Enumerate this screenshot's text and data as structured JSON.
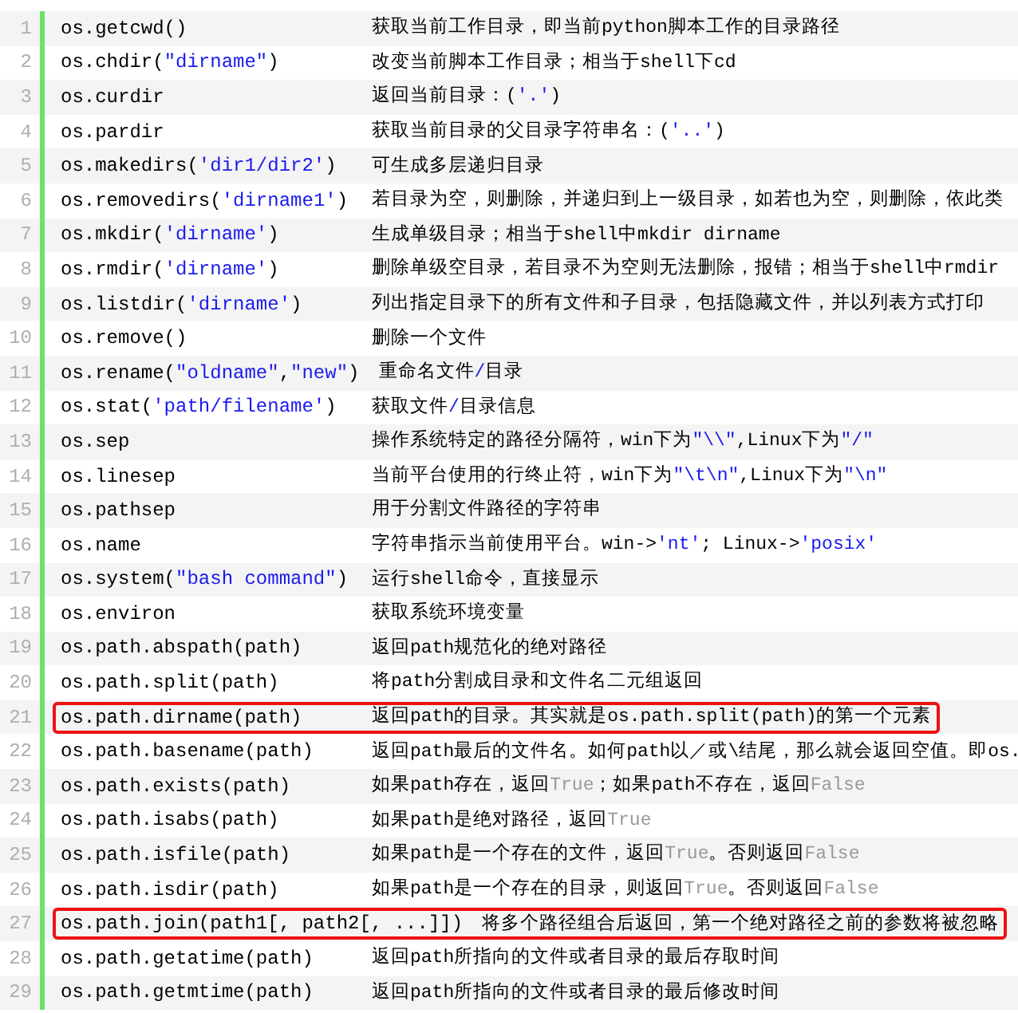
{
  "lines": [
    {
      "number": "1",
      "highlighted": false,
      "code": [
        {
          "text": "os.getcwd()",
          "kind": "plain"
        }
      ],
      "description": [
        {
          "text": "获取当前工作目录，即当前python脚本工作的目录路径",
          "kind": "plain"
        }
      ]
    },
    {
      "number": "2",
      "highlighted": false,
      "code": [
        {
          "text": "os.chdir(",
          "kind": "plain"
        },
        {
          "text": "\"dirname\"",
          "kind": "string"
        },
        {
          "text": ")",
          "kind": "plain"
        }
      ],
      "description": [
        {
          "text": "改变当前脚本工作目录；相当于shell下cd",
          "kind": "plain"
        }
      ]
    },
    {
      "number": "3",
      "highlighted": false,
      "code": [
        {
          "text": "os.curdir",
          "kind": "plain"
        }
      ],
      "description": [
        {
          "text": "返回当前目录：(",
          "kind": "plain"
        },
        {
          "text": "'.'",
          "kind": "string"
        },
        {
          "text": ")",
          "kind": "plain"
        }
      ]
    },
    {
      "number": "4",
      "highlighted": false,
      "code": [
        {
          "text": "os.pardir",
          "kind": "plain"
        }
      ],
      "description": [
        {
          "text": "获取当前目录的父目录字符串名：(",
          "kind": "plain"
        },
        {
          "text": "'..'",
          "kind": "string"
        },
        {
          "text": ")",
          "kind": "plain"
        }
      ]
    },
    {
      "number": "5",
      "highlighted": false,
      "code": [
        {
          "text": "os.makedirs(",
          "kind": "plain"
        },
        {
          "text": "'dir1/dir2'",
          "kind": "string"
        },
        {
          "text": ")",
          "kind": "plain"
        }
      ],
      "description": [
        {
          "text": "可生成多层递归目录",
          "kind": "plain"
        }
      ]
    },
    {
      "number": "6",
      "highlighted": false,
      "code": [
        {
          "text": "os.removedirs(",
          "kind": "plain"
        },
        {
          "text": "'dirname1'",
          "kind": "string"
        },
        {
          "text": ")",
          "kind": "plain"
        }
      ],
      "description": [
        {
          "text": "若目录为空，则删除，并递归到上一级目录，如若也为空，则删除，依此类",
          "kind": "plain"
        }
      ]
    },
    {
      "number": "7",
      "highlighted": false,
      "code": [
        {
          "text": "os.mkdir(",
          "kind": "plain"
        },
        {
          "text": "'dirname'",
          "kind": "string"
        },
        {
          "text": ")",
          "kind": "plain"
        }
      ],
      "description": [
        {
          "text": "生成单级目录；相当于shell中mkdir dirname",
          "kind": "plain"
        }
      ]
    },
    {
      "number": "8",
      "highlighted": false,
      "code": [
        {
          "text": "os.rmdir(",
          "kind": "plain"
        },
        {
          "text": "'dirname'",
          "kind": "string"
        },
        {
          "text": ")",
          "kind": "plain"
        }
      ],
      "description": [
        {
          "text": "删除单级空目录，若目录不为空则无法删除，报错；相当于shell中rmdir",
          "kind": "plain"
        }
      ]
    },
    {
      "number": "9",
      "highlighted": false,
      "code": [
        {
          "text": "os.listdir(",
          "kind": "plain"
        },
        {
          "text": "'dirname'",
          "kind": "string"
        },
        {
          "text": ")",
          "kind": "plain"
        }
      ],
      "description": [
        {
          "text": "列出指定目录下的所有文件和子目录，包括隐藏文件，并以列表方式打印",
          "kind": "plain"
        }
      ]
    },
    {
      "number": "10",
      "highlighted": false,
      "code": [
        {
          "text": "os.remove()",
          "kind": "plain"
        }
      ],
      "description": [
        {
          "text": "删除一个文件",
          "kind": "plain"
        }
      ]
    },
    {
      "number": "11",
      "highlighted": false,
      "code": [
        {
          "text": "os.rename(",
          "kind": "plain"
        },
        {
          "text": "\"oldname\"",
          "kind": "string"
        },
        {
          "text": ",",
          "kind": "plain"
        },
        {
          "text": "\"new\"",
          "kind": "string"
        },
        {
          "text": ")",
          "kind": "plain"
        }
      ],
      "description": [
        {
          "text": "重命名文件",
          "kind": "plain"
        },
        {
          "text": "/",
          "kind": "string"
        },
        {
          "text": "目录",
          "kind": "plain"
        }
      ]
    },
    {
      "number": "12",
      "highlighted": false,
      "code": [
        {
          "text": "os.stat(",
          "kind": "plain"
        },
        {
          "text": "'path/filename'",
          "kind": "string"
        },
        {
          "text": ")",
          "kind": "plain"
        }
      ],
      "description": [
        {
          "text": "获取文件",
          "kind": "plain"
        },
        {
          "text": "/",
          "kind": "string"
        },
        {
          "text": "目录信息",
          "kind": "plain"
        }
      ]
    },
    {
      "number": "13",
      "highlighted": false,
      "code": [
        {
          "text": "os.sep",
          "kind": "plain"
        }
      ],
      "description": [
        {
          "text": "操作系统特定的路径分隔符，win下为",
          "kind": "plain"
        },
        {
          "text": "\"\\\\\"",
          "kind": "string"
        },
        {
          "text": ",Linux下为",
          "kind": "plain"
        },
        {
          "text": "\"/\"",
          "kind": "string"
        }
      ]
    },
    {
      "number": "14",
      "highlighted": false,
      "code": [
        {
          "text": "os.linesep",
          "kind": "plain"
        }
      ],
      "description": [
        {
          "text": "当前平台使用的行终止符，win下为",
          "kind": "plain"
        },
        {
          "text": "\"\\t\\n\"",
          "kind": "string"
        },
        {
          "text": ",Linux下为",
          "kind": "plain"
        },
        {
          "text": "\"\\n\"",
          "kind": "string"
        }
      ]
    },
    {
      "number": "15",
      "highlighted": false,
      "code": [
        {
          "text": "os.pathsep",
          "kind": "plain"
        }
      ],
      "description": [
        {
          "text": "用于分割文件路径的字符串",
          "kind": "plain"
        }
      ]
    },
    {
      "number": "16",
      "highlighted": false,
      "code": [
        {
          "text": "os.name",
          "kind": "plain"
        }
      ],
      "description": [
        {
          "text": "字符串指示当前使用平台。win->",
          "kind": "plain"
        },
        {
          "text": "'nt'",
          "kind": "string"
        },
        {
          "text": "; Linux->",
          "kind": "plain"
        },
        {
          "text": "'posix'",
          "kind": "string"
        }
      ]
    },
    {
      "number": "17",
      "highlighted": false,
      "code": [
        {
          "text": "os.system(",
          "kind": "plain"
        },
        {
          "text": "\"bash command\"",
          "kind": "string"
        },
        {
          "text": ")",
          "kind": "plain"
        }
      ],
      "description": [
        {
          "text": "运行shell命令，直接显示",
          "kind": "plain"
        }
      ]
    },
    {
      "number": "18",
      "highlighted": false,
      "code": [
        {
          "text": "os.environ",
          "kind": "plain"
        }
      ],
      "description": [
        {
          "text": "获取系统环境变量",
          "kind": "plain"
        }
      ]
    },
    {
      "number": "19",
      "highlighted": false,
      "code": [
        {
          "text": "os.path.abspath(path)",
          "kind": "plain"
        }
      ],
      "description": [
        {
          "text": "返回path规范化的绝对路径",
          "kind": "plain"
        }
      ]
    },
    {
      "number": "20",
      "highlighted": false,
      "code": [
        {
          "text": "os.path.split(path)",
          "kind": "plain"
        }
      ],
      "description": [
        {
          "text": "将path分割成目录和文件名二元组返回",
          "kind": "plain"
        }
      ]
    },
    {
      "number": "21",
      "highlighted": true,
      "code": [
        {
          "text": "os.path.dirname(path)",
          "kind": "plain"
        }
      ],
      "description": [
        {
          "text": "返回path的目录。其实就是os.path.split(path)的第一个元素",
          "kind": "plain"
        }
      ]
    },
    {
      "number": "22",
      "highlighted": false,
      "code": [
        {
          "text": "os.path.basename(path)",
          "kind": "plain"
        }
      ],
      "description": [
        {
          "text": "返回path最后的文件名。如何path以／或\\结尾，那么就会返回空值。即os.",
          "kind": "plain"
        }
      ]
    },
    {
      "number": "23",
      "highlighted": false,
      "code": [
        {
          "text": "os.path.exists(path)",
          "kind": "plain"
        }
      ],
      "description": [
        {
          "text": "如果path存在，返回",
          "kind": "plain"
        },
        {
          "text": "True",
          "kind": "keyword"
        },
        {
          "text": "；如果path不存在，返回",
          "kind": "plain"
        },
        {
          "text": "False",
          "kind": "keyword"
        }
      ]
    },
    {
      "number": "24",
      "highlighted": false,
      "code": [
        {
          "text": "os.path.isabs(path)",
          "kind": "plain"
        }
      ],
      "description": [
        {
          "text": "如果path是绝对路径，返回",
          "kind": "plain"
        },
        {
          "text": "True",
          "kind": "keyword"
        }
      ]
    },
    {
      "number": "25",
      "highlighted": false,
      "code": [
        {
          "text": "os.path.isfile(path)",
          "kind": "plain"
        }
      ],
      "description": [
        {
          "text": "如果path是一个存在的文件，返回",
          "kind": "plain"
        },
        {
          "text": "True",
          "kind": "keyword"
        },
        {
          "text": "。否则返回",
          "kind": "plain"
        },
        {
          "text": "False",
          "kind": "keyword"
        }
      ]
    },
    {
      "number": "26",
      "highlighted": false,
      "code": [
        {
          "text": "os.path.isdir(path)",
          "kind": "plain"
        }
      ],
      "description": [
        {
          "text": "如果path是一个存在的目录，则返回",
          "kind": "plain"
        },
        {
          "text": "True",
          "kind": "keyword"
        },
        {
          "text": "。否则返回",
          "kind": "plain"
        },
        {
          "text": "False",
          "kind": "keyword"
        }
      ]
    },
    {
      "number": "27",
      "highlighted": true,
      "code": [
        {
          "text": "os.path.join(path1[, path2[, ...]])",
          "kind": "plain"
        }
      ],
      "description": [
        {
          "text": "将多个路径组合后返回，第一个绝对路径之前的参数将被忽略",
          "kind": "plain"
        }
      ]
    },
    {
      "number": "28",
      "highlighted": false,
      "code": [
        {
          "text": "os.path.getatime(path)",
          "kind": "plain"
        }
      ],
      "description": [
        {
          "text": "返回path所指向的文件或者目录的最后存取时间",
          "kind": "plain"
        }
      ]
    },
    {
      "number": "29",
      "highlighted": false,
      "code": [
        {
          "text": "os.path.getmtime(path)",
          "kind": "plain"
        }
      ],
      "description": [
        {
          "text": "返回path所指向的文件或者目录的最后修改时间",
          "kind": "plain"
        }
      ]
    }
  ]
}
